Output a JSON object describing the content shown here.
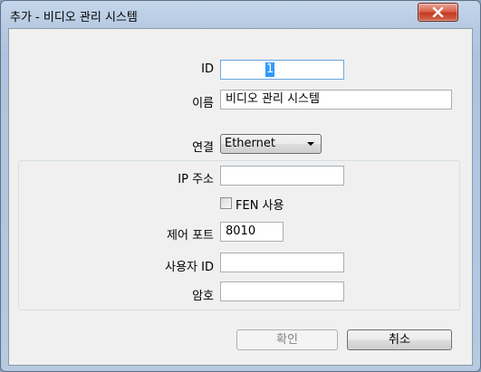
{
  "window": {
    "title": "추가 - 비디오 관리 시스템"
  },
  "form": {
    "id_label": "ID",
    "id_value": "1",
    "name_label": "이름",
    "name_value": "비디오 관리 시스템",
    "connection_label": "연결",
    "connection_value": "Ethernet",
    "ip_label": "IP 주소",
    "ip_value": "",
    "fen_label": "FEN 사용",
    "fen_checked": false,
    "port_label": "제어 포트",
    "port_value": "8010",
    "user_label": "사용자 ID",
    "user_value": "",
    "password_label": "암호",
    "password_value": ""
  },
  "buttons": {
    "ok_label": "확인",
    "cancel_label": "취소"
  }
}
